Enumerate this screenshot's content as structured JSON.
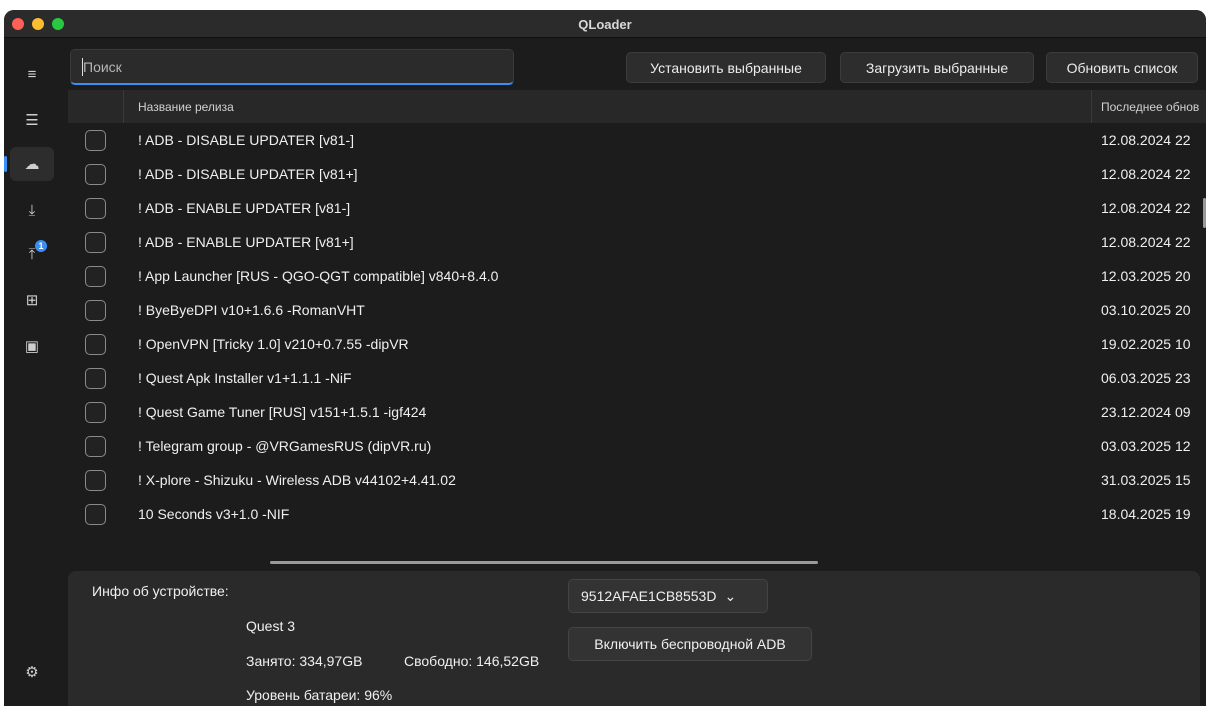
{
  "window": {
    "title": "QLoader"
  },
  "sidebar": {
    "items": [
      {
        "icon": "hamburger-menu-icon",
        "glyph": "≡"
      },
      {
        "icon": "list-icon",
        "glyph": "☰"
      },
      {
        "icon": "cloud-icon",
        "glyph": "☁",
        "active": true
      },
      {
        "icon": "download-icon",
        "glyph": "⤓"
      },
      {
        "icon": "upload-icon",
        "glyph": "⤒",
        "badge": "1"
      },
      {
        "icon": "apps-icon",
        "glyph": "⊞"
      },
      {
        "icon": "save-icon",
        "glyph": "▣"
      }
    ],
    "settings_glyph": "⚙"
  },
  "toolbar": {
    "search_placeholder": "Поиск",
    "install_label": "Установить выбранные",
    "download_label": "Загрузить выбранные",
    "refresh_label": "Обновить список"
  },
  "table": {
    "col_name": "Название релиза",
    "col_date": "Последнее обнов",
    "rows": [
      {
        "name": "! ADB - DISABLE UPDATER [v81-]",
        "date": "12.08.2024 22"
      },
      {
        "name": "! ADB - DISABLE UPDATER [v81+]",
        "date": "12.08.2024 22"
      },
      {
        "name": "! ADB - ENABLE UPDATER [v81-]",
        "date": "12.08.2024 22"
      },
      {
        "name": "! ADB - ENABLE UPDATER [v81+]",
        "date": "12.08.2024 22"
      },
      {
        "name": "! App Launcher [RUS - QGO-QGT compatible] v840+8.4.0",
        "date": "12.03.2025 20"
      },
      {
        "name": "! ByeByeDPI v10+1.6.6 -RomanVHT",
        "date": "03.10.2025 20"
      },
      {
        "name": "! OpenVPN [Tricky 1.0] v210+0.7.55 -dipVR",
        "date": "19.02.2025 10"
      },
      {
        "name": "! Quest Apk Installer v1+1.1.1 -NiF",
        "date": "06.03.2025 23"
      },
      {
        "name": "! Quest Game Tuner [RUS] v151+1.5.1 -igf424",
        "date": "23.12.2024 09"
      },
      {
        "name": "! Telegram group - @VRGamesRUS (dipVR.ru)",
        "date": "03.03.2025 12"
      },
      {
        "name": "! X-plore - Shizuku - Wireless ADB v44102+4.41.02",
        "date": "31.03.2025 15"
      },
      {
        "name": "10 Seconds v3+1.0 -NIF",
        "date": "18.04.2025 19"
      }
    ]
  },
  "device": {
    "label": "Инфо об устройстве:",
    "model": "Quest 3",
    "used": "Занято: 334,97GB",
    "free": "Свободно: 146,52GB",
    "battery": "Уровень батареи: 96%",
    "serial": "9512AFAE1CB8553D",
    "wireless_label": "Включить беспроводной ADB"
  },
  "colors": {
    "accent": "#3a8ef6",
    "background": "#1c1c1c",
    "panel": "#2a2a2a"
  }
}
